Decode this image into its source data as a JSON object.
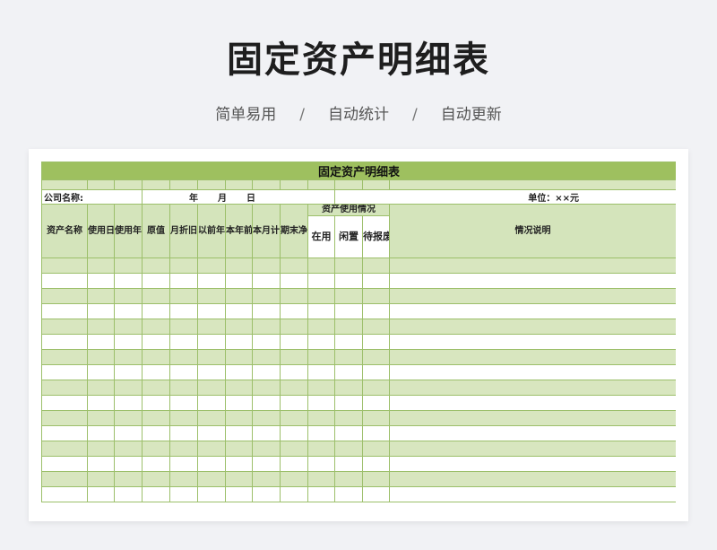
{
  "page": {
    "title": "固定资产明细表",
    "features": [
      "简单易用",
      "自动统计",
      "自动更新"
    ],
    "separator": "/"
  },
  "sheet": {
    "title": "固定资产明细表",
    "company_label": "公司名称:",
    "date_year": "年",
    "date_month": "月",
    "date_day": "日",
    "unit_label": "单位：××元",
    "headers": {
      "asset_name": "资产名称",
      "use_date": "使用日期",
      "use_years": "使用年限",
      "original_value": "原值",
      "monthly_depreciation": "月折旧",
      "accumulated_depreciation": "以前年度累计折旧",
      "current_year_depreciation": "本年前期已提折旧",
      "current_month_depreciation": "本月计提折旧",
      "net_value": "期末净值",
      "usage_status": "资产使用情况",
      "in_use": "在用",
      "idle": "闲置",
      "scrap": "待报废",
      "notes": "情况说明"
    }
  },
  "colors": {
    "title_bar": "#9ec05f",
    "header_fill": "#d4e4bb",
    "row_stripe": "#d8e6bf",
    "grid_line": "#9cbf6a"
  }
}
